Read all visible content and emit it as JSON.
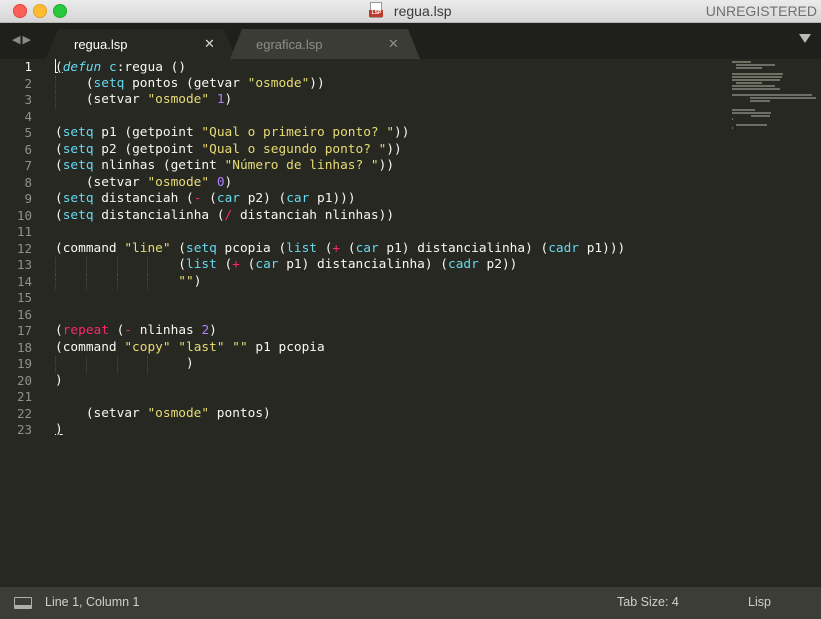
{
  "window": {
    "title": "regua.lsp",
    "license": "UNREGISTERED",
    "file_badge": "LSP"
  },
  "tabs": [
    {
      "label": "regua.lsp",
      "active": true,
      "close_glyph": "✕"
    },
    {
      "label": "egrafica.lsp",
      "active": false,
      "close_glyph": "✕"
    }
  ],
  "nav": {
    "back_glyph": "◀",
    "forward_glyph": "▶"
  },
  "editor": {
    "current_line": 1,
    "line_numbers": [
      "1",
      "2",
      "3",
      "4",
      "5",
      "6",
      "7",
      "8",
      "9",
      "10",
      "11",
      "12",
      "13",
      "14",
      "15",
      "16",
      "17",
      "18",
      "19",
      "20",
      "21",
      "22",
      "23"
    ],
    "lines": [
      [
        {
          "t": "p",
          "v": "("
        },
        {
          "t": "it",
          "v": "defun"
        },
        {
          "t": "p",
          "v": " "
        },
        {
          "t": "fn",
          "v": "c"
        },
        {
          "t": "p",
          "v": ":regua ()"
        }
      ],
      [
        {
          "t": "p",
          "v": "    ("
        },
        {
          "t": "fn",
          "v": "setq"
        },
        {
          "t": "p",
          "v": " pontos (getvar "
        },
        {
          "t": "str",
          "v": "\"osmode\""
        },
        {
          "t": "p",
          "v": "))"
        }
      ],
      [
        {
          "t": "p",
          "v": "    (setvar "
        },
        {
          "t": "str",
          "v": "\"osmode\""
        },
        {
          "t": "p",
          "v": " "
        },
        {
          "t": "num",
          "v": "1"
        },
        {
          "t": "p",
          "v": ")"
        }
      ],
      [],
      [
        {
          "t": "p",
          "v": "("
        },
        {
          "t": "fn",
          "v": "setq"
        },
        {
          "t": "p",
          "v": " p1 (getpoint "
        },
        {
          "t": "str",
          "v": "\"Qual o primeiro ponto? \""
        },
        {
          "t": "p",
          "v": "))"
        }
      ],
      [
        {
          "t": "p",
          "v": "("
        },
        {
          "t": "fn",
          "v": "setq"
        },
        {
          "t": "p",
          "v": " p2 (getpoint "
        },
        {
          "t": "str",
          "v": "\"Qual o segundo ponto? \""
        },
        {
          "t": "p",
          "v": "))"
        }
      ],
      [
        {
          "t": "p",
          "v": "("
        },
        {
          "t": "fn",
          "v": "setq"
        },
        {
          "t": "p",
          "v": " nlinhas (getint "
        },
        {
          "t": "str",
          "v": "\"Número de linhas? \""
        },
        {
          "t": "p",
          "v": "))"
        }
      ],
      [
        {
          "t": "p",
          "v": "    (setvar "
        },
        {
          "t": "str",
          "v": "\"osmode\""
        },
        {
          "t": "p",
          "v": " "
        },
        {
          "t": "num",
          "v": "0"
        },
        {
          "t": "p",
          "v": ")"
        }
      ],
      [
        {
          "t": "p",
          "v": "("
        },
        {
          "t": "fn",
          "v": "setq"
        },
        {
          "t": "p",
          "v": " distanciah ("
        },
        {
          "t": "kw",
          "v": "-"
        },
        {
          "t": "p",
          "v": " ("
        },
        {
          "t": "fn",
          "v": "car"
        },
        {
          "t": "p",
          "v": " p2) ("
        },
        {
          "t": "fn",
          "v": "car"
        },
        {
          "t": "p",
          "v": " p1)))"
        }
      ],
      [
        {
          "t": "p",
          "v": "("
        },
        {
          "t": "fn",
          "v": "setq"
        },
        {
          "t": "p",
          "v": " distancialinha ("
        },
        {
          "t": "kw",
          "v": "/"
        },
        {
          "t": "p",
          "v": " distanciah nlinhas))"
        }
      ],
      [],
      [
        {
          "t": "p",
          "v": "(command "
        },
        {
          "t": "str",
          "v": "\"line\""
        },
        {
          "t": "p",
          "v": " ("
        },
        {
          "t": "fn",
          "v": "setq"
        },
        {
          "t": "p",
          "v": " pcopia ("
        },
        {
          "t": "fn",
          "v": "list"
        },
        {
          "t": "p",
          "v": " ("
        },
        {
          "t": "kw",
          "v": "+"
        },
        {
          "t": "p",
          "v": " ("
        },
        {
          "t": "fn",
          "v": "car"
        },
        {
          "t": "p",
          "v": " p1) distancialinha) ("
        },
        {
          "t": "fn",
          "v": "cadr"
        },
        {
          "t": "p",
          "v": " p1)))"
        }
      ],
      [
        {
          "t": "p",
          "v": "                ("
        },
        {
          "t": "fn",
          "v": "list"
        },
        {
          "t": "p",
          "v": " ("
        },
        {
          "t": "kw",
          "v": "+"
        },
        {
          "t": "p",
          "v": " ("
        },
        {
          "t": "fn",
          "v": "car"
        },
        {
          "t": "p",
          "v": " p1) distancialinha) ("
        },
        {
          "t": "fn",
          "v": "cadr"
        },
        {
          "t": "p",
          "v": " p2))"
        }
      ],
      [
        {
          "t": "p",
          "v": "                "
        },
        {
          "t": "str",
          "v": "\"\""
        },
        {
          "t": "p",
          "v": ")"
        }
      ],
      [],
      [],
      [
        {
          "t": "p",
          "v": "("
        },
        {
          "t": "kw",
          "v": "repeat"
        },
        {
          "t": "p",
          "v": " ("
        },
        {
          "t": "kw",
          "v": "-"
        },
        {
          "t": "p",
          "v": " nlinhas "
        },
        {
          "t": "num",
          "v": "2"
        },
        {
          "t": "p",
          "v": ")"
        }
      ],
      [
        {
          "t": "p",
          "v": "(command "
        },
        {
          "t": "str",
          "v": "\"copy\""
        },
        {
          "t": "p",
          "v": " "
        },
        {
          "t": "str",
          "v": "\"last\""
        },
        {
          "t": "p",
          "v": " "
        },
        {
          "t": "str",
          "v": "\"\""
        },
        {
          "t": "p",
          "v": " p1 pcopia"
        }
      ],
      [
        {
          "t": "p",
          "v": "                 )"
        }
      ],
      [
        {
          "t": "p",
          "v": ")"
        }
      ],
      [],
      [
        {
          "t": "p",
          "v": "    (setvar "
        },
        {
          "t": "str",
          "v": "\"osmode\""
        },
        {
          "t": "p",
          "v": " pontos)"
        }
      ],
      [
        {
          "t": "p",
          "v": ")"
        }
      ]
    ]
  },
  "status": {
    "cursor": "Line 1, Column 1",
    "tab_size": "Tab Size: 4",
    "syntax": "Lisp"
  },
  "colors": {
    "background": "#272822",
    "keyword": "#f92672",
    "function": "#66d9ef",
    "string": "#e6db74",
    "number": "#ae81ff",
    "text": "#f8f8f2"
  }
}
